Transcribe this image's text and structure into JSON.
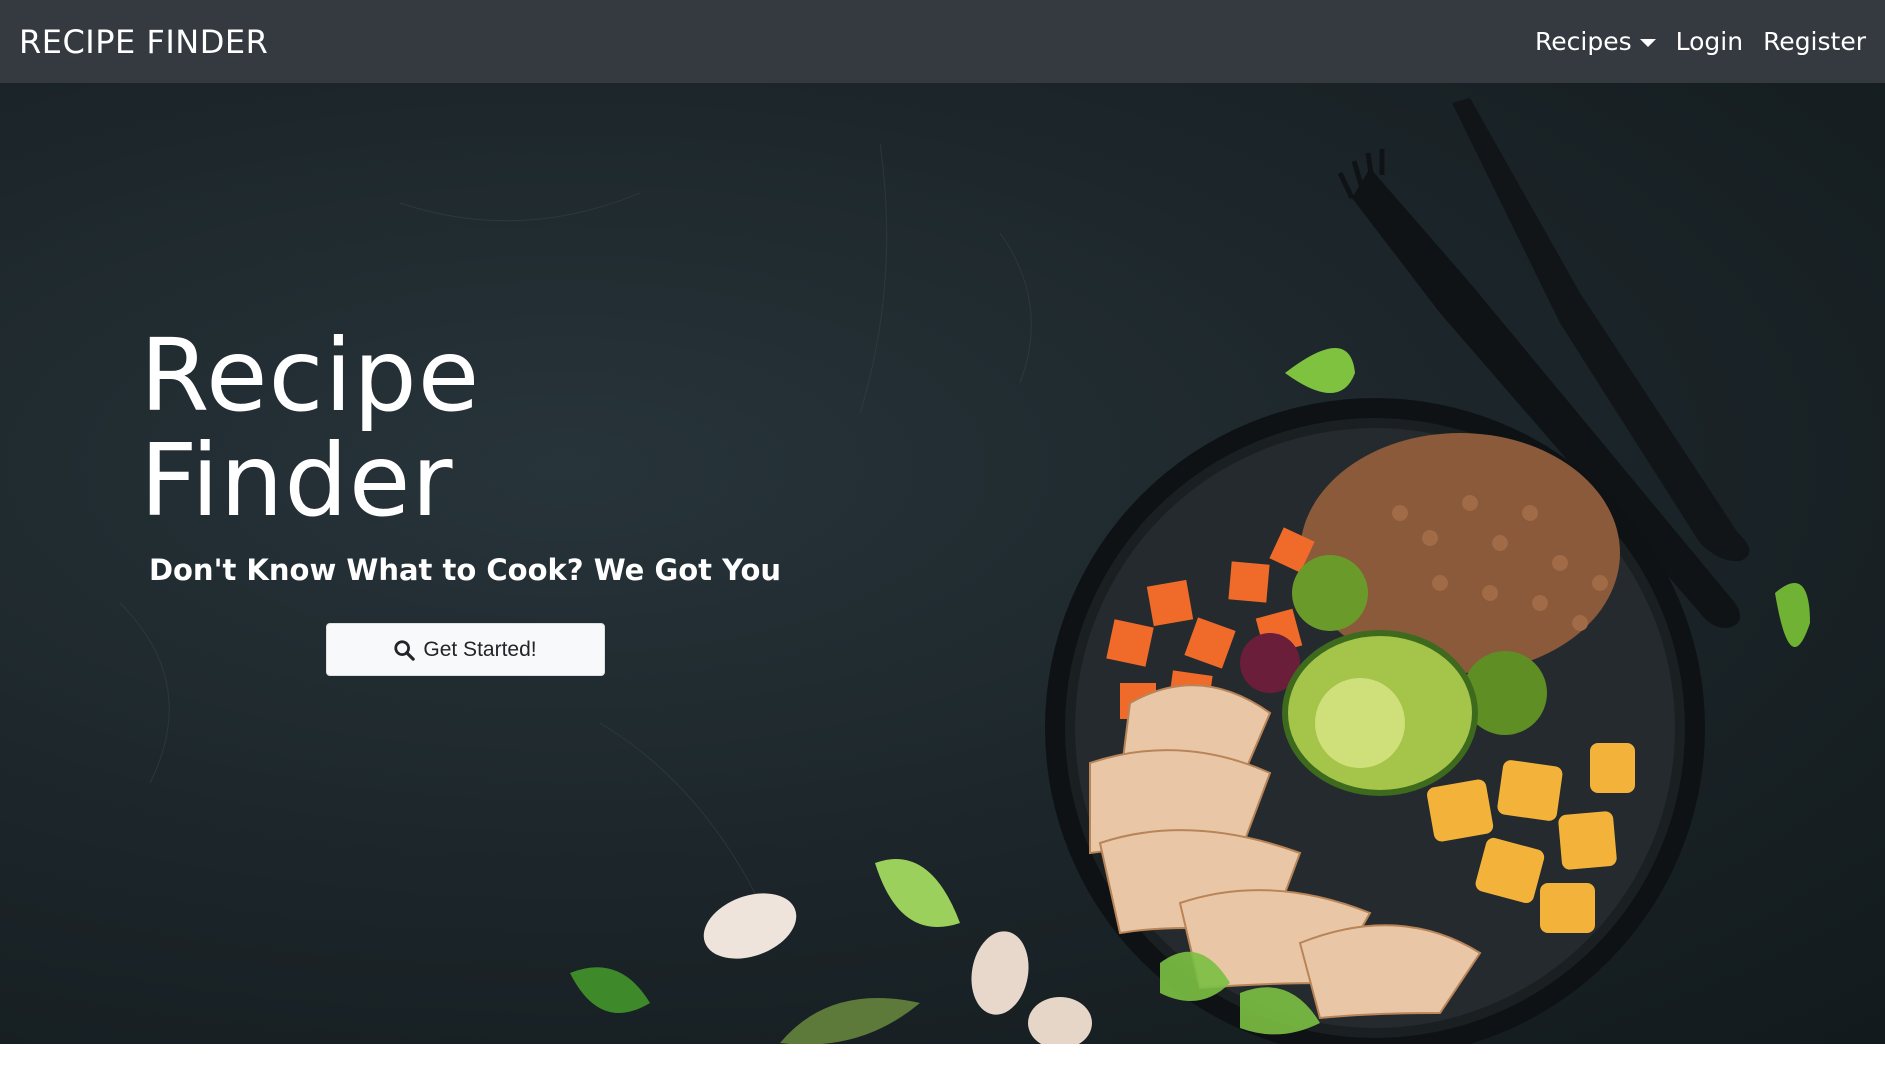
{
  "navbar": {
    "brand": "RECIPE FINDER",
    "links": [
      {
        "label": "Recipes",
        "dropdown": true
      },
      {
        "label": "Login",
        "dropdown": false
      },
      {
        "label": "Register",
        "dropdown": false
      }
    ]
  },
  "hero": {
    "title": "Recipe Finder",
    "subtitle": "Don't Know What to Cook? We Got You",
    "cta_label": "Get Started!",
    "cta_icon": "search-icon",
    "image": "food-bowl-with-cutlery"
  },
  "colors": {
    "navbar_bg": "#343a40",
    "hero_bg": "#1b2428",
    "text": "#ffffff",
    "button_bg": "#f8f9fa"
  }
}
